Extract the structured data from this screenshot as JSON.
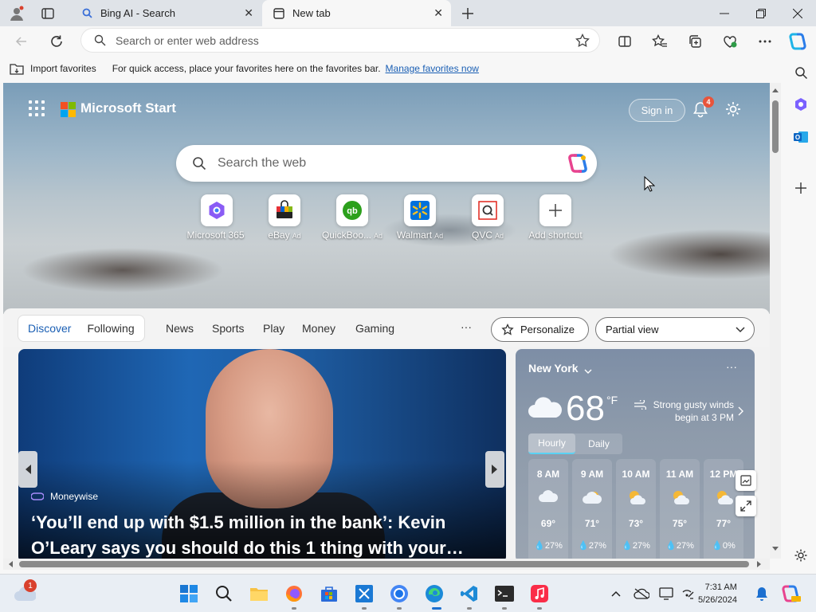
{
  "browser": {
    "tabs": [
      {
        "title": "Bing AI - Search",
        "favicon": "search-icon"
      },
      {
        "title": "New tab",
        "favicon": "new-tab-icon"
      }
    ],
    "address_placeholder": "Search or enter web address"
  },
  "favorites_bar": {
    "import_label": "Import favorites",
    "hint": "For quick access, place your favorites here on the favorites bar.",
    "manage_link": "Manage favorites now"
  },
  "start": {
    "brand": "Microsoft Start",
    "signin_label": "Sign in",
    "notification_count": "4",
    "search_placeholder": "Search the web",
    "shortcuts": [
      {
        "label": "Microsoft 365",
        "ad": ""
      },
      {
        "label": "eBay",
        "ad": "Ad"
      },
      {
        "label": "QuickBoo...",
        "ad": "Ad"
      },
      {
        "label": "Walmart",
        "ad": "Ad"
      },
      {
        "label": "QVC",
        "ad": "Ad"
      },
      {
        "label": "Add shortcut",
        "ad": ""
      }
    ]
  },
  "feed": {
    "toggle": {
      "active": "Discover",
      "inactive": "Following"
    },
    "tabs": [
      "News",
      "Sports",
      "Play",
      "Money",
      "Gaming"
    ],
    "more": "···",
    "personalize_label": "Personalize",
    "view_select": "Partial view"
  },
  "news_card": {
    "source": "Moneywise",
    "headline": "‘You’ll end up with $1.5 million in the bank’: Kevin O’Leary says you should do this 1 thing with your…"
  },
  "weather": {
    "location": "New York",
    "temp": "68",
    "unit": "°F",
    "alert": "Strong gusty winds begin at 3 PM",
    "seg_hourly": "Hourly",
    "seg_daily": "Daily",
    "more": "···",
    "hours": [
      {
        "time": "8 AM",
        "temp": "69°",
        "precip": "27%",
        "icon": "cloud-icon"
      },
      {
        "time": "9 AM",
        "temp": "71°",
        "precip": "27%",
        "icon": "partly-cloudy-icon"
      },
      {
        "time": "10 AM",
        "temp": "73°",
        "precip": "27%",
        "icon": "partly-sunny-icon"
      },
      {
        "time": "11 AM",
        "temp": "75°",
        "precip": "27%",
        "icon": "partly-sunny-icon"
      },
      {
        "time": "12 PM",
        "temp": "77°",
        "precip": "0%",
        "icon": "partly-sunny-icon"
      }
    ]
  },
  "taskbar": {
    "weather_badge": "1",
    "time": "7:31 AM",
    "date": "5/26/2024"
  }
}
